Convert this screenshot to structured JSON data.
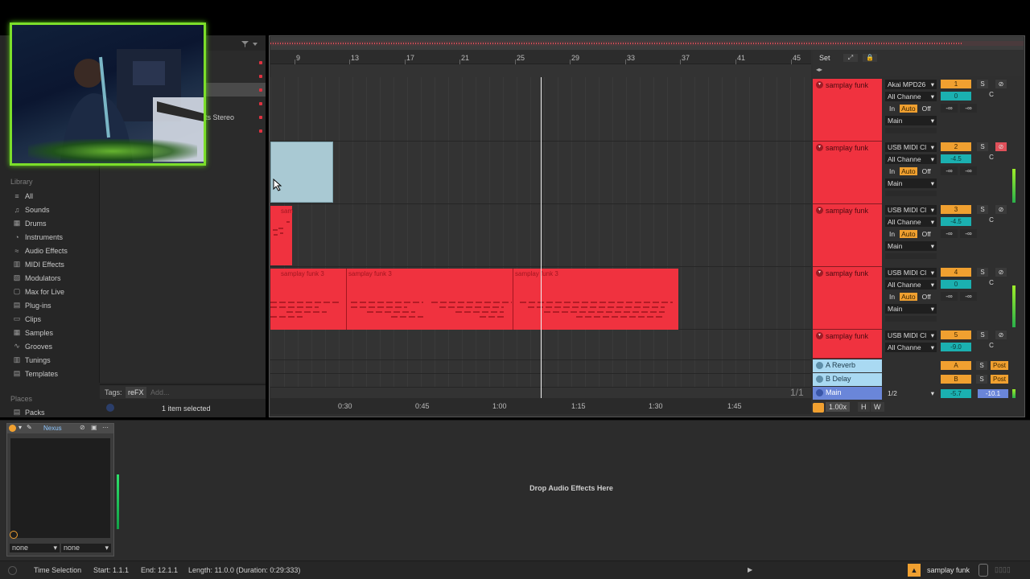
{
  "browser": {
    "library_heading": "Library",
    "places_heading": "Places",
    "categories": [
      {
        "icon": "list-icon",
        "label": "All"
      },
      {
        "icon": "sounds-icon",
        "label": "Sounds"
      },
      {
        "icon": "drums-icon",
        "label": "Drums"
      },
      {
        "icon": "instruments-icon",
        "label": "Instruments"
      },
      {
        "icon": "audio-effects-icon",
        "label": "Audio Effects"
      },
      {
        "icon": "midi-effects-icon",
        "label": "MIDI Effects"
      },
      {
        "icon": "modulators-icon",
        "label": "Modulators"
      },
      {
        "icon": "max-icon",
        "label": "Max for Live"
      },
      {
        "icon": "plugin-icon",
        "label": "Plug-ins"
      },
      {
        "icon": "clips-icon",
        "label": "Clips"
      },
      {
        "icon": "samples-icon",
        "label": "Samples"
      },
      {
        "icon": "grooves-icon",
        "label": "Grooves"
      },
      {
        "icon": "tunings-icon",
        "label": "Tunings"
      },
      {
        "icon": "templates-icon",
        "label": "Templates"
      }
    ],
    "places": [
      {
        "label": "Packs"
      }
    ],
    "file_visible_text": "ts Stereo",
    "tags_label": "Tags:",
    "tag": "reFX",
    "tag_add_placeholder": "Add...",
    "selection_status": "1 item selected"
  },
  "arrangement": {
    "bar_numbers": [
      "9",
      "13",
      "17",
      "21",
      "25",
      "29",
      "33",
      "37",
      "41",
      "45"
    ],
    "time_labels": [
      "0:30",
      "0:45",
      "1:00",
      "1:15",
      "1:30",
      "1:45"
    ],
    "page_indicator": "1/1",
    "clip_labels": [
      "sam",
      "samplay funk 3",
      "samplay funk 3",
      "samplay funk 3"
    ]
  },
  "tracks": [
    {
      "name": "samplay funk",
      "input": "Akai MPD26",
      "channel": "All Channe",
      "monitor": [
        "In",
        "Auto",
        "Off"
      ],
      "output": "Main",
      "number": "1",
      "volume": "0",
      "pan": "C",
      "sends": [
        "-∞",
        "-∞"
      ],
      "solo": "S"
    },
    {
      "name": "samplay funk",
      "input": "USB MIDI Cl",
      "channel": "All Channe",
      "monitor": [
        "In",
        "Auto",
        "Off"
      ],
      "output": "Main",
      "number": "2",
      "volume": "-4.5",
      "pan": "C",
      "sends": [
        "-∞",
        "-∞"
      ],
      "solo": "S"
    },
    {
      "name": "samplay funk",
      "input": "USB MIDI Cl",
      "channel": "All Channe",
      "monitor": [
        "In",
        "Auto",
        "Off"
      ],
      "output": "Main",
      "number": "3",
      "volume": "-4.5",
      "pan": "C",
      "sends": [
        "-∞",
        "-∞"
      ],
      "solo": "S"
    },
    {
      "name": "samplay funk",
      "input": "USB MIDI Cl",
      "channel": "All Channe",
      "monitor": [
        "In",
        "Auto",
        "Off"
      ],
      "output": "Main",
      "number": "4",
      "volume": "0",
      "pan": "C",
      "sends": [
        "-∞",
        "-∞"
      ],
      "solo": "S"
    },
    {
      "name": "samplay funk",
      "input": "USB MIDI Cl",
      "channel": "All Channe",
      "number": "5",
      "volume": "-9.0",
      "pan": "C",
      "solo": "S"
    }
  ],
  "returns": [
    {
      "name": "A Reverb",
      "letter": "A",
      "solo": "S",
      "post": "Post"
    },
    {
      "name": "B Delay",
      "letter": "B",
      "solo": "S",
      "post": "Post"
    }
  ],
  "main_track": {
    "name": "Main",
    "routing": "1/2",
    "volume": "-5.7",
    "peak": "-10.1"
  },
  "set_controls": {
    "set_label": "Set",
    "tempo_scale": "1.00x",
    "h_label": "H",
    "w_label": "W"
  },
  "device": {
    "name": "Nexus",
    "select_left": "none",
    "select_right": "none",
    "drop_hint": "Drop Audio Effects Here"
  },
  "status_bar": {
    "mode": "Time Selection",
    "start": "Start: 1.1.1",
    "end": "End: 12.1.1",
    "length": "Length: 11.0.0 (Duration: 0:29:333)",
    "track_name": "samplay funk"
  },
  "colors": {
    "clip_red": "#f0323f",
    "clip_blue": "#a9c9d3",
    "auto_orange": "#f0a030",
    "volume_teal": "#1bb0b0",
    "return_blue": "#a9d9f2",
    "main_blue": "#6a86d9",
    "webcam_frame": "#7cde2a"
  }
}
